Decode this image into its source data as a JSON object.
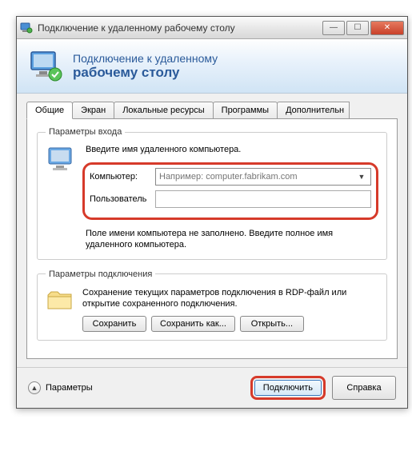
{
  "titlebar": {
    "text": "Подключение к удаленному рабочему столу"
  },
  "banner": {
    "line1": "Подключение к удаленному",
    "line2": "рабочему столу"
  },
  "tabs": [
    {
      "label": "Общие",
      "active": true
    },
    {
      "label": "Экран",
      "active": false
    },
    {
      "label": "Локальные ресурсы",
      "active": false
    },
    {
      "label": "Программы",
      "active": false
    },
    {
      "label": "Дополнительн",
      "active": false
    }
  ],
  "login": {
    "legend": "Параметры входа",
    "instruction": "Введите имя удаленного компьютера.",
    "computer_label": "Компьютер:",
    "computer_placeholder": "Например: computer.fabrikam.com",
    "computer_value": "",
    "user_label": "Пользователь",
    "user_value": "",
    "warning": "Поле имени компьютера не заполнено. Введите полное имя удаленного компьютера."
  },
  "connset": {
    "legend": "Параметры подключения",
    "description": "Сохранение текущих параметров подключения в RDP-файл или открытие сохраненного подключения.",
    "save": "Сохранить",
    "save_as": "Сохранить как...",
    "open": "Открыть..."
  },
  "footer": {
    "options": "Параметры",
    "connect": "Подключить",
    "help": "Справка"
  }
}
